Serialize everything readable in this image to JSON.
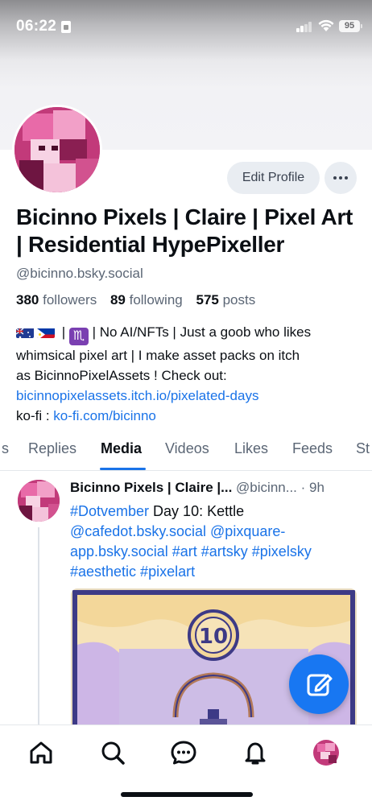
{
  "status_bar": {
    "time": "06:22",
    "battery": "95"
  },
  "profile": {
    "display_name": "Bicinno Pixels | Claire | Pixel Art | Residential HypePixeller",
    "handle": "@bicinno.bsky.social",
    "followers_count": "380",
    "followers_label": "followers",
    "following_count": "89",
    "following_label": "following",
    "posts_count": "575",
    "posts_label": "posts",
    "edit_label": "Edit Profile",
    "more_label": "···",
    "bio": {
      "line1_text": " | ",
      "line1_rest": " | No AI/NFTs | Just a goob who likes",
      "line2": "whimsical pixel art | I make asset packs on itch",
      "line3": "as BicinnoPixelAssets ! Check out:",
      "link1": "bicinnopixelassets.itch.io/pixelated-days",
      "kofi_label": "ko-fi : ",
      "link2": "ko-fi.com/bicinno",
      "zodiac": "♏"
    }
  },
  "tabs": [
    {
      "label": "s"
    },
    {
      "label": "Replies"
    },
    {
      "label": "Media"
    },
    {
      "label": "Videos"
    },
    {
      "label": "Likes"
    },
    {
      "label": "Feeds"
    },
    {
      "label": "St"
    }
  ],
  "active_tab": "Media",
  "post": {
    "author": "Bicinno Pixels | Claire |...",
    "handle": "@bicinn...",
    "time": "· 9h",
    "hashtag1": "#Dotvember",
    "text1": " Day 10: Kettle",
    "mention1": "@cafedot.bsky.social",
    "mention2": "@pixquare-app.bsky.social",
    "tags": "#art #artsky #pixelsky #aesthetic #pixelart",
    "image_badge": "10"
  },
  "nav": [
    "home-icon",
    "search-icon",
    "chat-icon",
    "bell-icon",
    "profile-avatar"
  ],
  "colors": {
    "accent": "#1a73e8",
    "fab": "#1877f2",
    "avatar": "#c23a7a"
  }
}
